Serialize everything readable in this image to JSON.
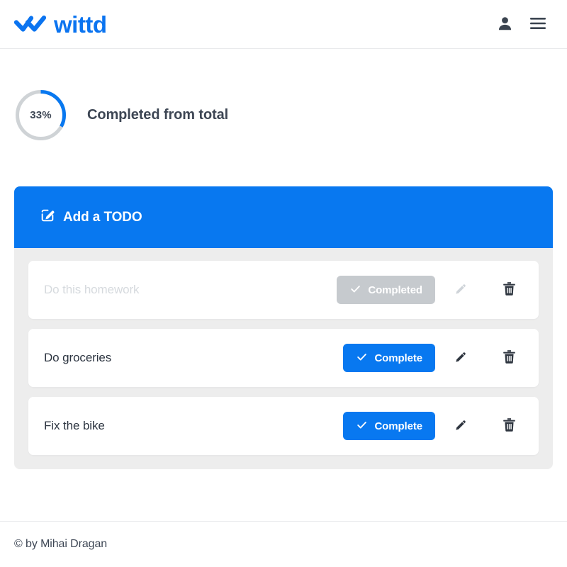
{
  "header": {
    "brand_name": "wittd",
    "logo_icon": "double-check-logo",
    "account_icon": "person-icon",
    "menu_icon": "hamburger-menu-icon"
  },
  "progress": {
    "percent_label": "33%",
    "percent_value": 33,
    "caption": "Completed from total",
    "track_color": "#cfd3d6",
    "fill_color": "#0878f0"
  },
  "panel": {
    "add_label": "Add a TODO",
    "add_icon": "compose-edit-icon",
    "accent_color": "#0878f0",
    "list_background": "#ededed"
  },
  "todos": [
    {
      "title": "Do this homework",
      "completed": true,
      "action_label": "Completed",
      "action_icon": "check-icon",
      "edit_icon": "pencil-icon",
      "delete_icon": "trash-icon"
    },
    {
      "title": "Do groceries",
      "completed": false,
      "action_label": "Complete",
      "action_icon": "check-icon",
      "edit_icon": "pencil-icon",
      "delete_icon": "trash-icon"
    },
    {
      "title": "Fix the bike",
      "completed": false,
      "action_label": "Complete",
      "action_icon": "check-icon",
      "edit_icon": "pencil-icon",
      "delete_icon": "trash-icon"
    }
  ],
  "footer": {
    "credit": "© by Mihai Dragan"
  }
}
